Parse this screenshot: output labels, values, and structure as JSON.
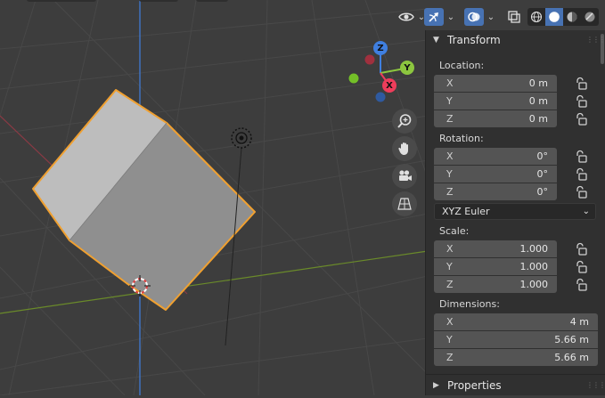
{
  "transform": {
    "title": "Transform",
    "location": {
      "label": "Location:",
      "fields": [
        {
          "axis": "X",
          "value": "0 m"
        },
        {
          "axis": "Y",
          "value": "0 m"
        },
        {
          "axis": "Z",
          "value": "0 m"
        }
      ]
    },
    "rotation": {
      "label": "Rotation:",
      "fields": [
        {
          "axis": "X",
          "value": "0°"
        },
        {
          "axis": "Y",
          "value": "0°"
        },
        {
          "axis": "Z",
          "value": "0°"
        }
      ],
      "mode": "XYZ Euler"
    },
    "scale": {
      "label": "Scale:",
      "fields": [
        {
          "axis": "X",
          "value": "1.000"
        },
        {
          "axis": "Y",
          "value": "1.000"
        },
        {
          "axis": "Z",
          "value": "1.000"
        }
      ]
    },
    "dimensions": {
      "label": "Dimensions:",
      "fields": [
        {
          "axis": "X",
          "value": "4 m"
        },
        {
          "axis": "Y",
          "value": "5.66 m"
        },
        {
          "axis": "Z",
          "value": "5.66 m"
        }
      ]
    }
  },
  "properties": {
    "title": "Properties"
  },
  "gizmo": {
    "x_label": "X",
    "y_label": "Y",
    "z_label": "Z"
  },
  "colors": {
    "accent": "#4772b3",
    "selection_outline": "#f0a030",
    "axis_x": "#ee3d5b",
    "axis_y": "#8cc63f",
    "axis_z": "#3f7fe0",
    "grid_line": "#484848"
  },
  "icons": {
    "visibility": "eye-icon",
    "gizmo": "gizmo-arrow-icon",
    "overlay": "overlay-icon",
    "xray": "xray-icon",
    "shading": [
      "wireframe-shading-icon",
      "solid-shading-icon",
      "material-shading-icon",
      "rendered-shading-icon"
    ],
    "navigation": [
      "zoom-icon",
      "hand-pan-icon",
      "camera-icon",
      "grid-perspective-icon"
    ]
  }
}
